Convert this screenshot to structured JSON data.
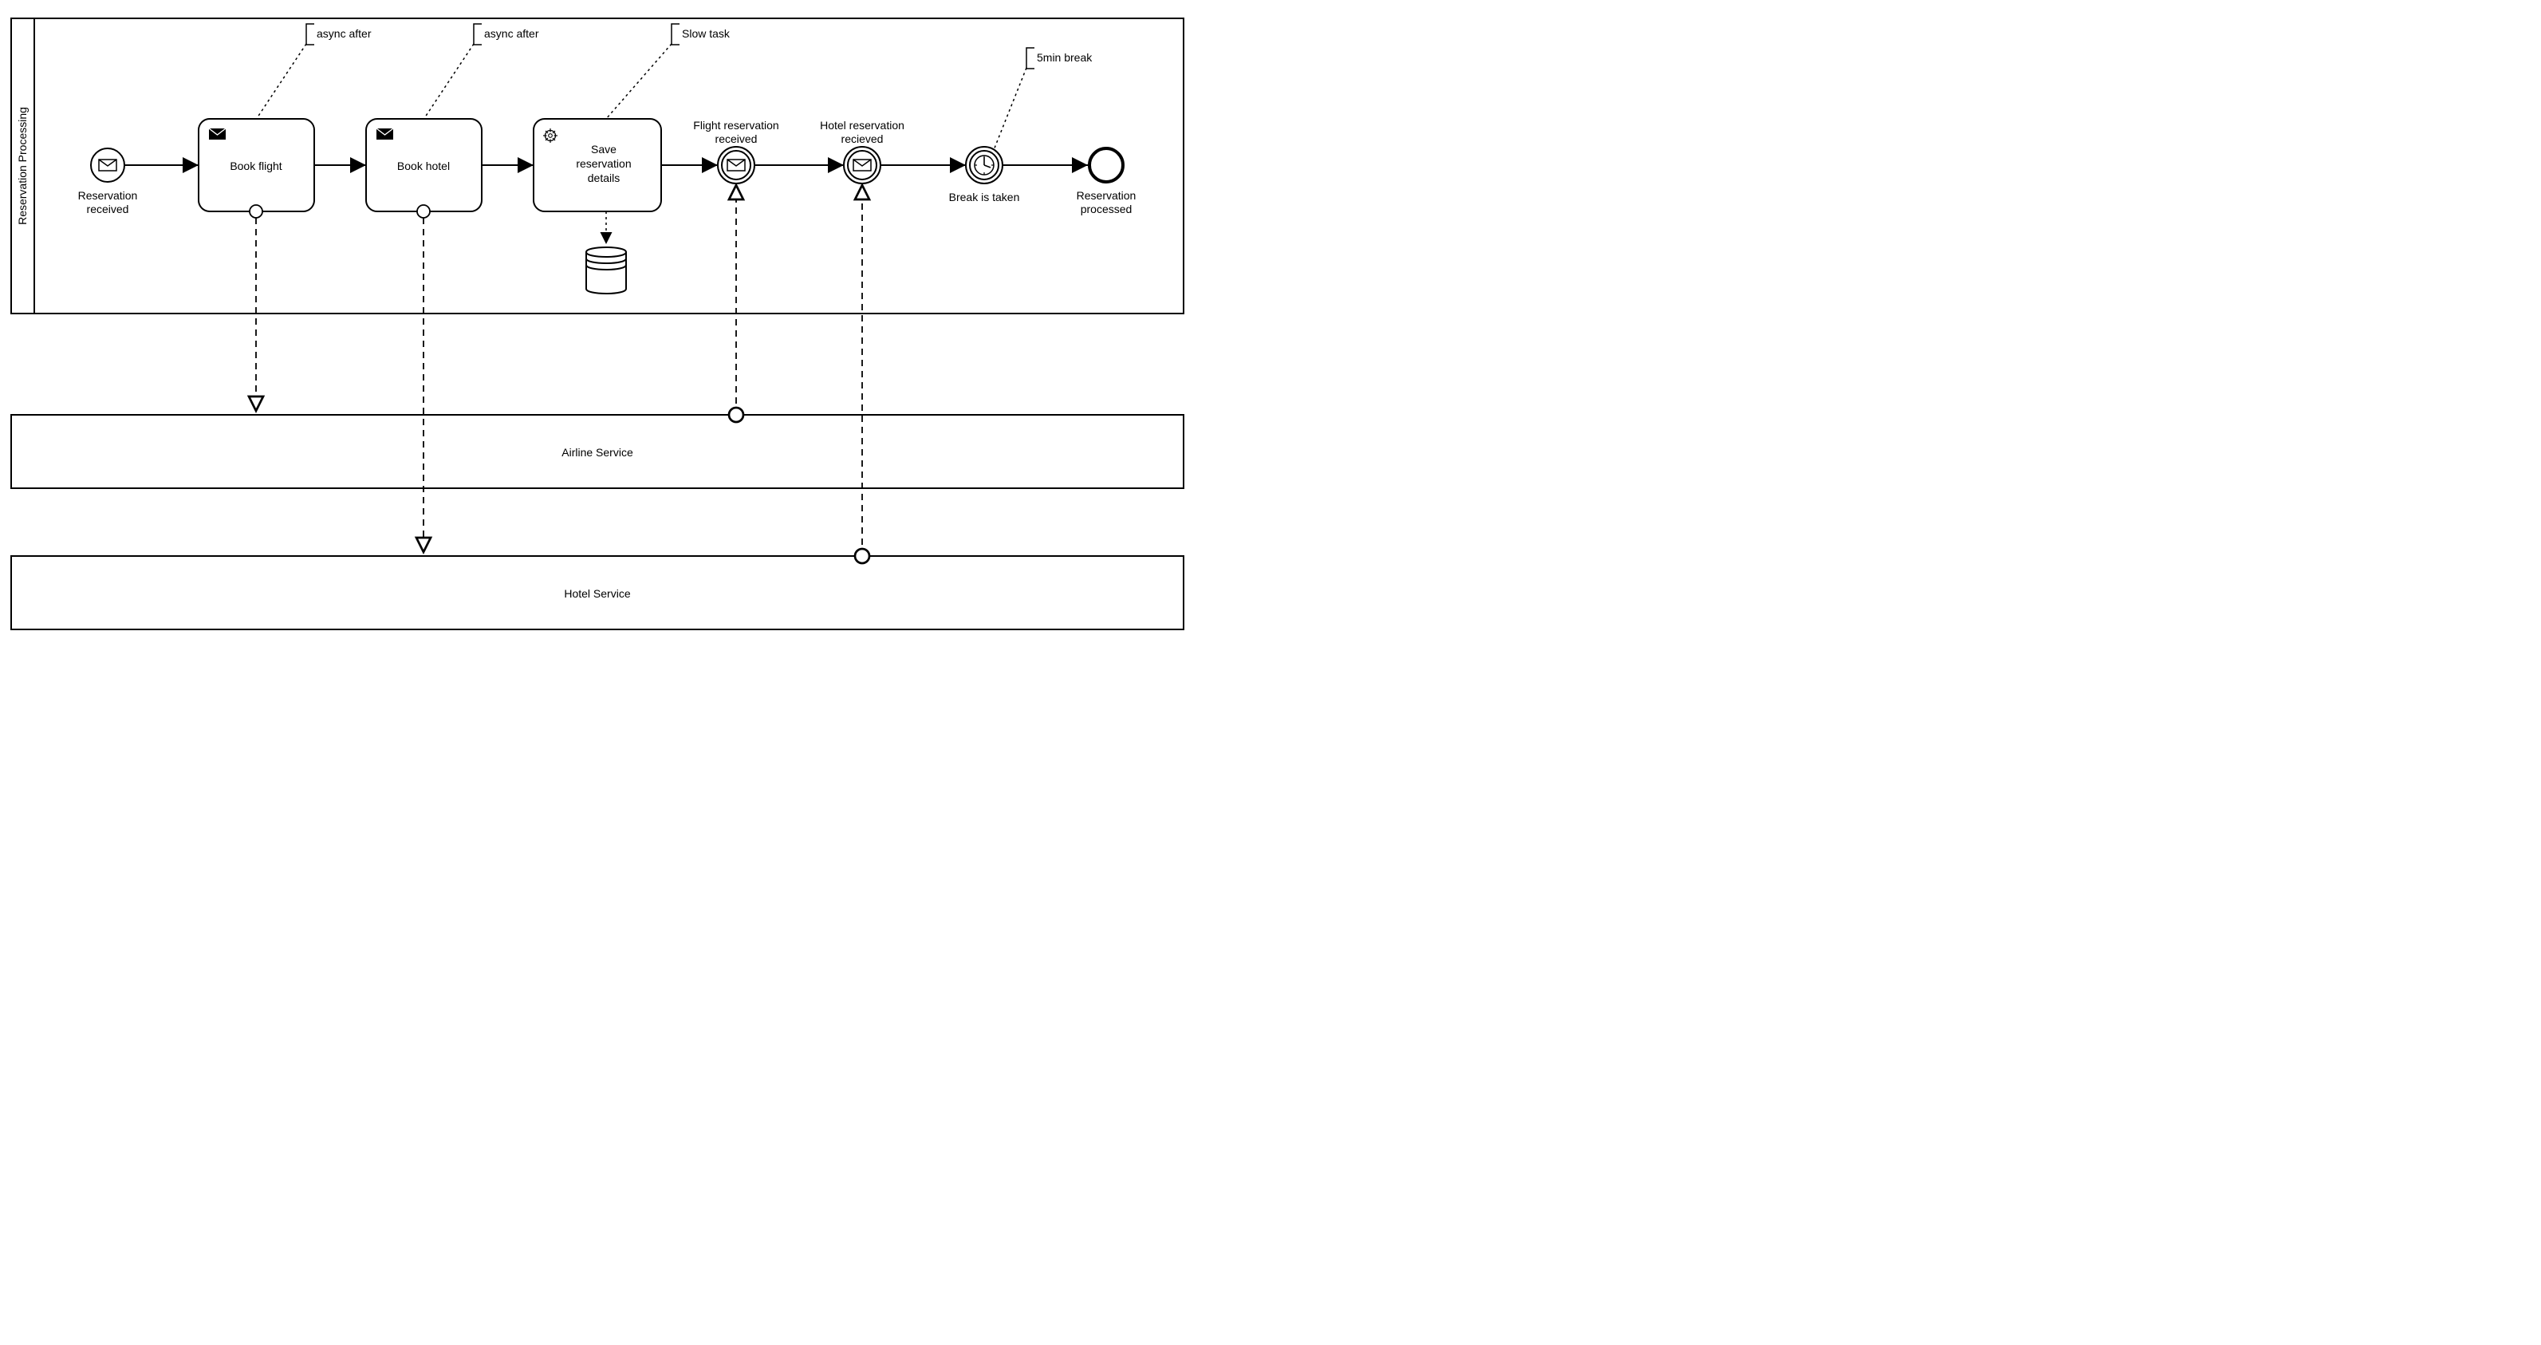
{
  "pool": {
    "lane_label": "Reservation Processing"
  },
  "participants": {
    "airline": "Airline Service",
    "hotel": "Hotel Service"
  },
  "events": {
    "start_label_l1": "Reservation",
    "start_label_l2": "received",
    "flight_recv_l1": "Flight reservation",
    "flight_recv_l2": "received",
    "hotel_recv_l1": "Hotel reservation",
    "hotel_recv_l2": "recieved",
    "break_label": "Break is taken",
    "end_label_l1": "Reservation",
    "end_label_l2": "processed"
  },
  "tasks": {
    "book_flight": "Book flight",
    "book_hotel": "Book hotel",
    "save_l1": "Save",
    "save_l2": "reservation",
    "save_l3": "details"
  },
  "annotations": {
    "async_after_1": "async after",
    "async_after_2": "async after",
    "slow_task": "Slow task",
    "break": "5min break"
  }
}
